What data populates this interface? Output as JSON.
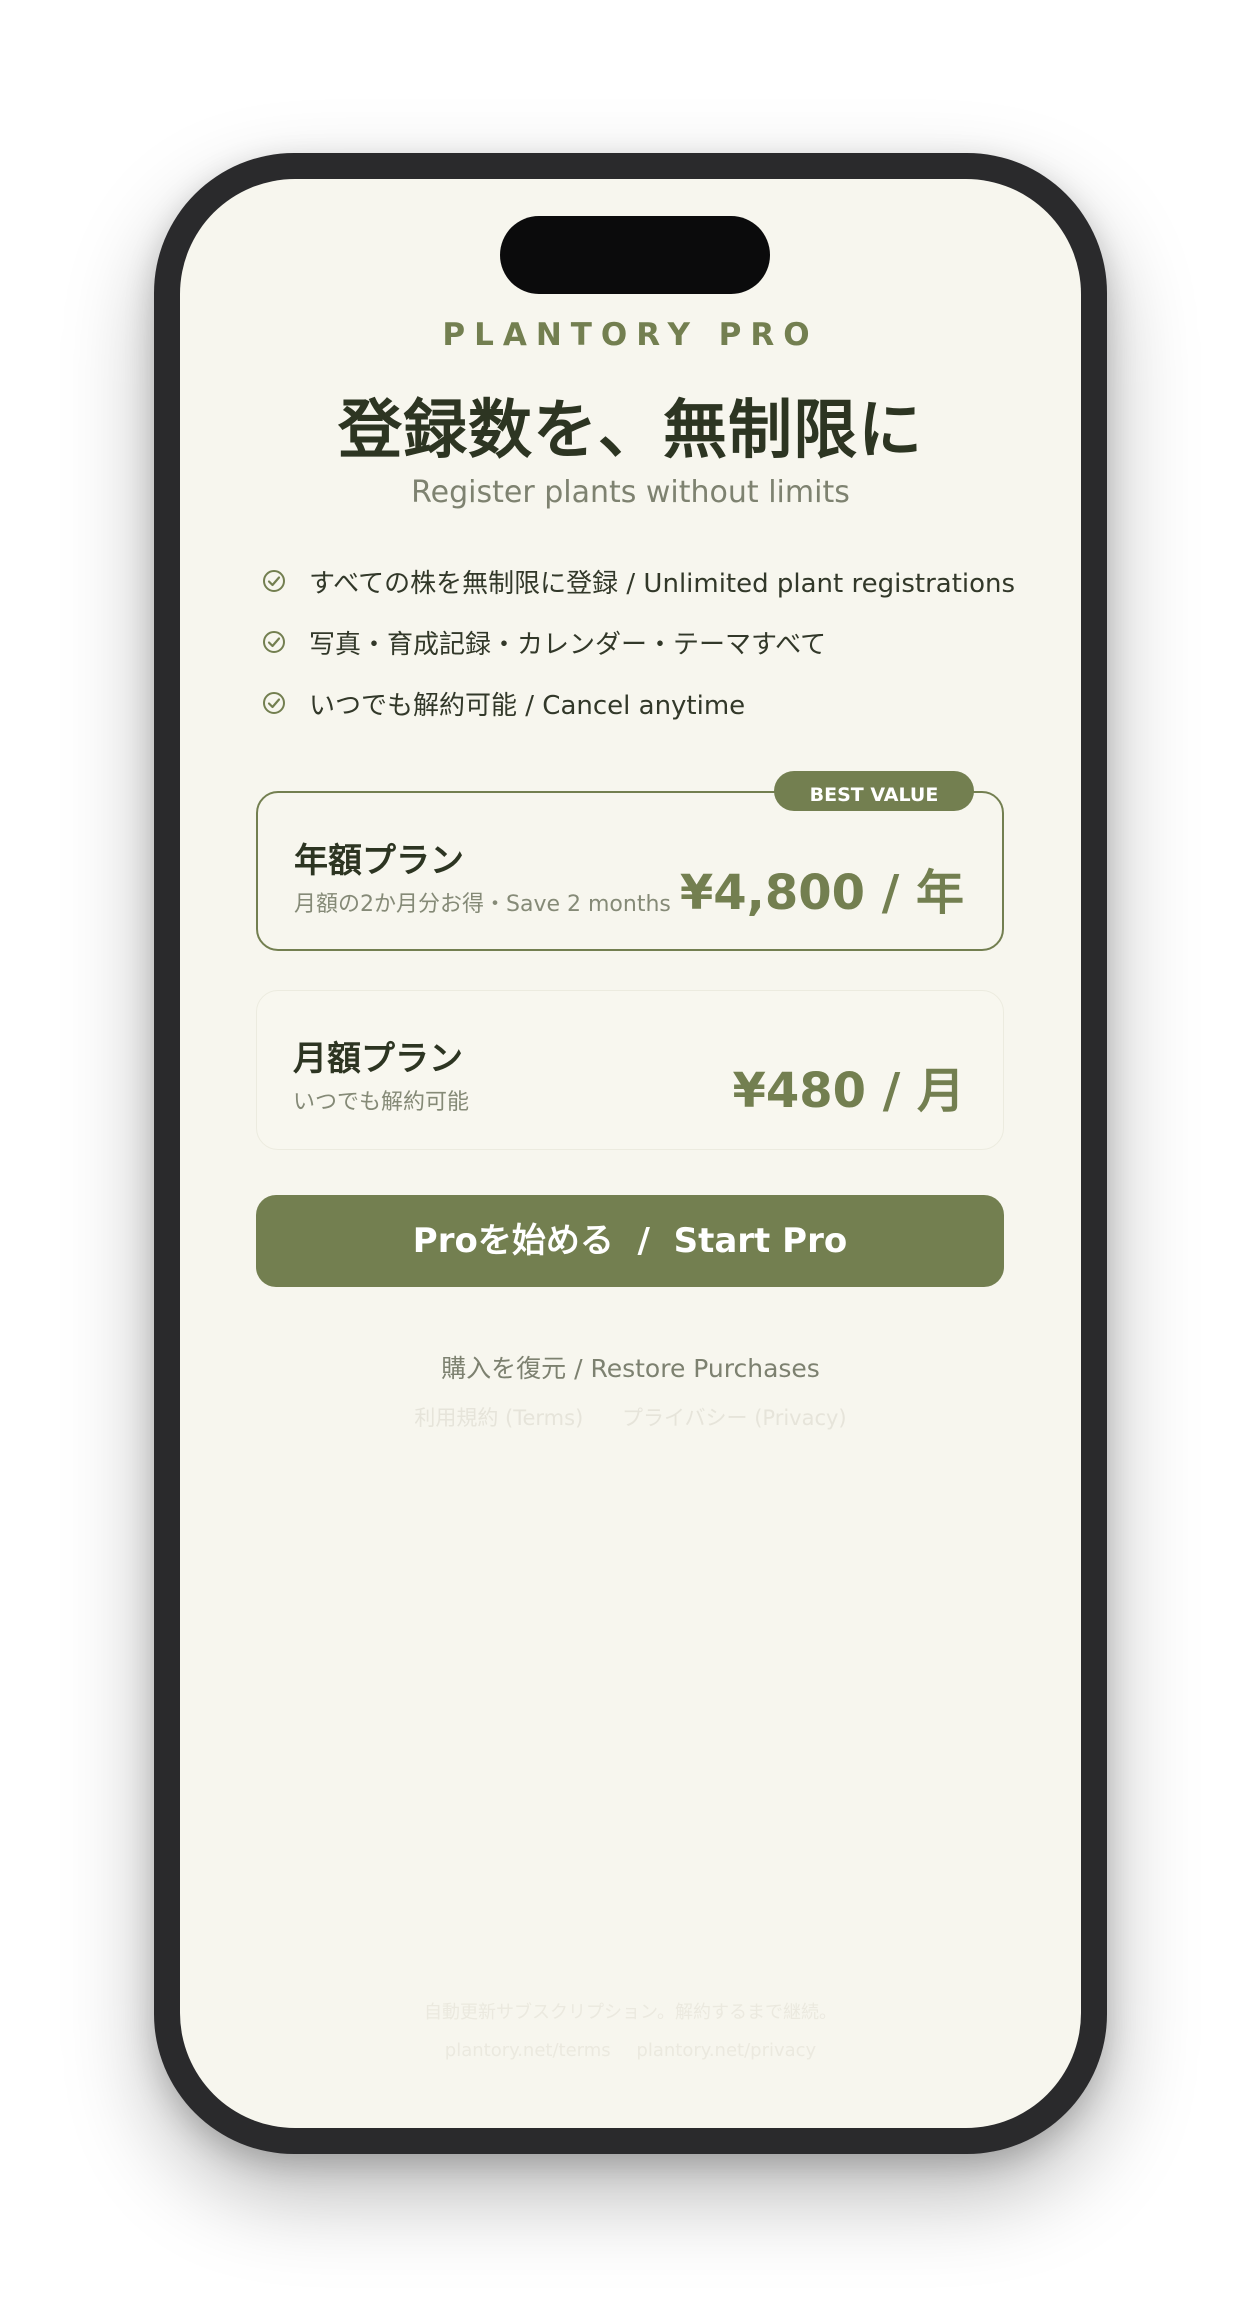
{
  "brand": "PLANTORY PRO",
  "headline": "登録数を、無制限に",
  "subheadline": "Register plants without limits",
  "features": [
    {
      "icon": "check-circle-icon",
      "text": "すべての株を無制限に登録 / Unlimited plant registrations"
    },
    {
      "icon": "check-circle-icon",
      "text": "写真・育成記録・カレンダー・テーマすべて"
    },
    {
      "icon": "check-circle-icon",
      "text": "いつでも解約可能 / Cancel anytime"
    }
  ],
  "plans": {
    "annual": {
      "badge": "BEST VALUE",
      "name": "年額プラン",
      "note": "月額の2か月分お得・Save 2 months",
      "price": "¥4,800 / 年",
      "selected": true
    },
    "monthly": {
      "name": "月額プラン",
      "note": "いつでも解約可能",
      "price": "¥480 / 月",
      "selected": false
    }
  },
  "cta_label": "Proを始める  /  Start Pro",
  "restore_label": "購入を復元 / Restore Purchases",
  "legal": {
    "terms_label": "利用規約 (Terms)",
    "privacy_label": "プライバシー (Privacy)",
    "fineprint": "自動更新サブスクリプション。解約するまで継続。",
    "terms_url": "plantory.net/terms",
    "privacy_url": "plantory.net/privacy"
  },
  "colors": {
    "accent": "#737f50",
    "background": "#f7f6ee",
    "text_dark": "#2d3522",
    "text_muted": "#7e8270",
    "device_frame": "#2a2a2c"
  }
}
